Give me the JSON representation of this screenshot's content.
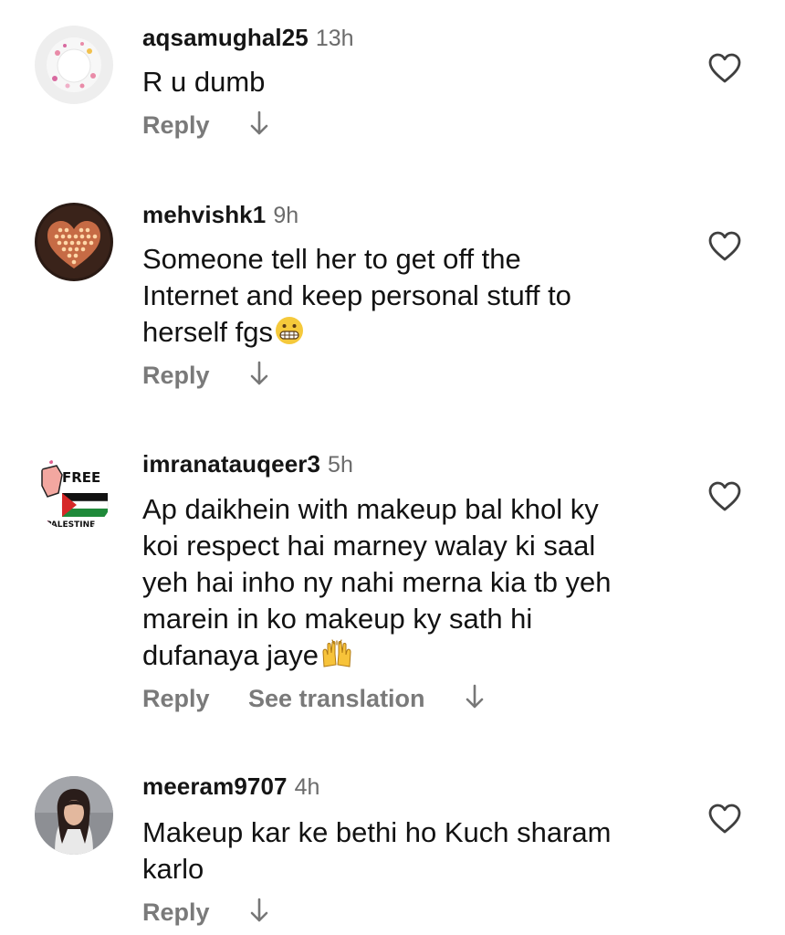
{
  "comments": [
    {
      "username": "aqsamughal25",
      "time": "13h",
      "lines": [
        "R u dumb"
      ],
      "actions": {
        "reply": "Reply"
      },
      "avatar": {
        "bg": "#eeeeee",
        "accent": "#e98ba8"
      }
    },
    {
      "username": "mehvishk1",
      "time": "9h",
      "lines": [
        "Someone tell her to get off the",
        "Internet and keep personal stuff to",
        "herself fgs"
      ],
      "emoji": "grimacing-face-emoji",
      "actions": {
        "reply": "Reply"
      },
      "avatar": {
        "bg": "#2a1a14",
        "accent": "#f2a070"
      }
    },
    {
      "username": "imranatauqeer3",
      "time": "5h",
      "lines": [
        "Ap daikhein with makeup bal khol ky",
        "koi respect hai marney walay ki saal",
        "yeh hai inho ny nahi merna kia tb yeh",
        "marein in ko makeup ky sath hi",
        "dufanaya jaye"
      ],
      "emoji": "raising-hands-emoji",
      "actions": {
        "reply": "Reply",
        "translate": "See translation"
      },
      "avatar": {
        "bg": "#ffffff",
        "top_text": "FREE",
        "bottom_text": "PALESTINE"
      }
    },
    {
      "username": "meeram9707",
      "time": "4h",
      "lines": [
        "Makeup kar ke bethi ho Kuch sharam",
        "karlo"
      ],
      "actions": {
        "reply": "Reply"
      },
      "avatar": {
        "bg": "#8d8f94",
        "accent": "#2a1d1a"
      }
    }
  ],
  "colors": {
    "username": "#151515",
    "meta": "#6b6b6b",
    "action": "#7a7a7a",
    "icon": "#444444"
  }
}
